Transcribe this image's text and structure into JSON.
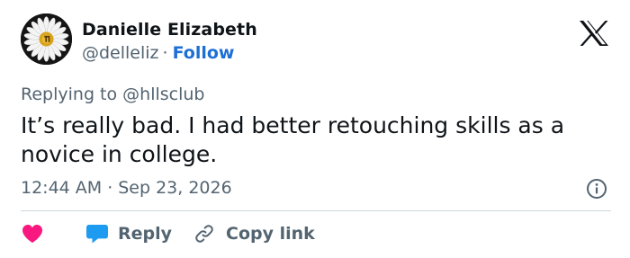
{
  "author": {
    "name": "Danielle Elizabeth",
    "handle": "@delleliz",
    "separator": "·",
    "follow_label": "Follow"
  },
  "reply_context": {
    "prefix": "Replying to ",
    "handle": "@hllsclub"
  },
  "tweet": {
    "text": "It’s really bad. I had better retouching skills as a novice in college.",
    "time": "12:44 AM",
    "separator": "·",
    "date": "Sep 23, 2026"
  },
  "actions": {
    "reply_label": "Reply",
    "copy_label": "Copy link"
  },
  "icons": {
    "like": "heart-icon",
    "reply": "speech-bubble-icon",
    "copy": "link-icon",
    "info": "info-icon",
    "brand": "x-logo-icon"
  },
  "colors": {
    "heart": "#f91880",
    "bubble": "#1d9bf0",
    "follow": "#1d6fd6",
    "muted": "#536471",
    "divider": "#cfd9de"
  }
}
